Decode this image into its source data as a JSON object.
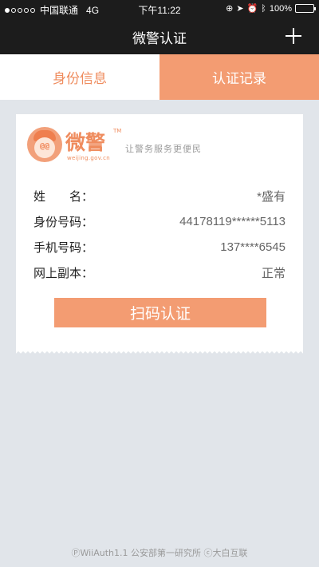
{
  "status_bar": {
    "carrier": "中国联通",
    "network": "4G",
    "time": "下午11:22",
    "battery": "100%",
    "battery_level": 1.0,
    "signal_bars_filled": 1
  },
  "nav": {
    "title": "微警认证"
  },
  "tabs": [
    {
      "label": "身份信息",
      "active": true
    },
    {
      "label": "认证记录",
      "active": false
    }
  ],
  "logo": {
    "text": "微警",
    "trademark": "TM",
    "url": "weijing.gov.cn",
    "eyes": "@@"
  },
  "slogan": "让警务服务更便民",
  "info": [
    {
      "label": "姓　　名：",
      "value": "*盛有"
    },
    {
      "label": "身份号码：",
      "value": "44178119******5113"
    },
    {
      "label": "手机号码：",
      "value": "137****6545"
    },
    {
      "label": "网上副本：",
      "value": "正常"
    }
  ],
  "scan_button": {
    "label": "扫码认证"
  },
  "footer": "ⓅWiiAuth1.1 公安部第一研究所 ⓒ大白互联",
  "colors": {
    "accent": "#f39c72",
    "accent_text": "#ef8c5e",
    "dark_bar": "#1c1c1c",
    "background": "#e1e5ea"
  }
}
